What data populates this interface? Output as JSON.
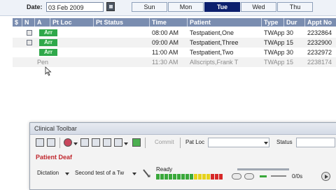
{
  "date_bar": {
    "label": "Date:",
    "value": "03 Feb 2009",
    "days": [
      {
        "label": "Sun",
        "active": false
      },
      {
        "label": "Mon",
        "active": false
      },
      {
        "label": "Tue",
        "active": true
      },
      {
        "label": "Wed",
        "active": false
      },
      {
        "label": "Thu",
        "active": false
      }
    ]
  },
  "grid": {
    "headers": [
      "$",
      "N",
      "A",
      "Pt Loc",
      "Pt Status",
      "Time",
      "Patient",
      "Type",
      "Dur",
      "Appt No"
    ],
    "rows": [
      {
        "arrival": "Arr",
        "time": "08:00 AM",
        "patient": "Testpatient,One",
        "type": "TWApp",
        "dur": "30",
        "appt": "2232864"
      },
      {
        "arrival": "Arr",
        "time": "09:00 AM",
        "patient": "Testpatient,Three",
        "type": "TWApp",
        "dur": "15",
        "appt": "2232900"
      },
      {
        "arrival": "Arr",
        "time": "11:00 AM",
        "patient": "Testpatient,Two",
        "type": "TWApp",
        "dur": "30",
        "appt": "2232972"
      },
      {
        "arrival": "Pen",
        "time": "11:30 AM",
        "patient": "Allscripts,Frank T",
        "type": "TWApp",
        "dur": "15",
        "appt": "2238174"
      }
    ]
  },
  "clinical_toolbar": {
    "title": "Clinical Toolbar",
    "commit_label": "Commit",
    "pat_loc_label": "Pat Loc",
    "status_label": "Status",
    "alert": "Patient Deaf",
    "dictation_label": "Dictation",
    "dictation_item": "Second test of a Tw",
    "ready_label": "Ready",
    "time_readout": "0/0s",
    "colors": {
      "meter_green": "#39a83a",
      "meter_yellow": "#e6d21b",
      "meter_red": "#d62828"
    }
  }
}
